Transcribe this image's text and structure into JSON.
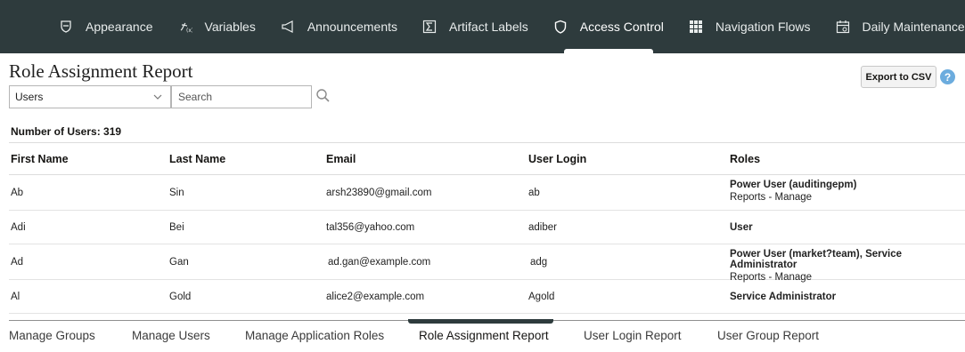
{
  "topnav": {
    "tabs": [
      {
        "label": "Appearance",
        "icon": "shield-outline-icon",
        "active": false
      },
      {
        "label": "Variables",
        "icon": "variables-icon",
        "active": false
      },
      {
        "label": "Announcements",
        "icon": "megaphone-icon",
        "active": false
      },
      {
        "label": "Artifact Labels",
        "icon": "sigma-icon",
        "active": false
      },
      {
        "label": "Access Control",
        "icon": "shield-icon",
        "active": true
      },
      {
        "label": "Navigation Flows",
        "icon": "grid-icon",
        "active": false
      },
      {
        "label": "Daily Maintenance",
        "icon": "calendar-icon",
        "active": false
      }
    ]
  },
  "page": {
    "title": "Role Assignment Report",
    "filter_value": "Users",
    "search_placeholder": "Search",
    "export_label": "Export to CSV",
    "help_label": "?",
    "count_text": "Number of Users: 319"
  },
  "table": {
    "headers": {
      "first": "First Name",
      "last": "Last Name",
      "email": "Email",
      "login": "User Login",
      "roles": "Roles"
    },
    "rows": [
      {
        "first": "Ab",
        "last": "Sin",
        "email": "arsh23890@gmail.com",
        "login": "ab",
        "role_main": "Power User (auditingepm)",
        "role_sub": "Reports - Manage"
      },
      {
        "first": "Adi",
        "last": "Bei",
        "email": "tal356@yahoo.com",
        "login": "adiber",
        "role_main": "User",
        "role_sub": ""
      },
      {
        "first": "Ad",
        "last": "Gan",
        "email": "ad.gan@example.com",
        "login": "adg",
        "role_main": "Power User (market?team), Service Administrator",
        "role_sub": "Reports - Manage"
      },
      {
        "first": "Al",
        "last": "Gold",
        "email": "alice2@example.com",
        "login": "Agold",
        "role_main": "Service Administrator",
        "role_sub": ""
      }
    ]
  },
  "bottom_tabs": [
    {
      "label": "Manage Groups",
      "active": false
    },
    {
      "label": "Manage Users",
      "active": false
    },
    {
      "label": "Manage Application Roles",
      "active": false
    },
    {
      "label": "Role Assignment Report",
      "active": true
    },
    {
      "label": "User Login Report",
      "active": false
    },
    {
      "label": "User Group Report",
      "active": false
    }
  ],
  "colors": {
    "nav_bg": "#2e3b3d",
    "help_blue": "#6cacde"
  }
}
